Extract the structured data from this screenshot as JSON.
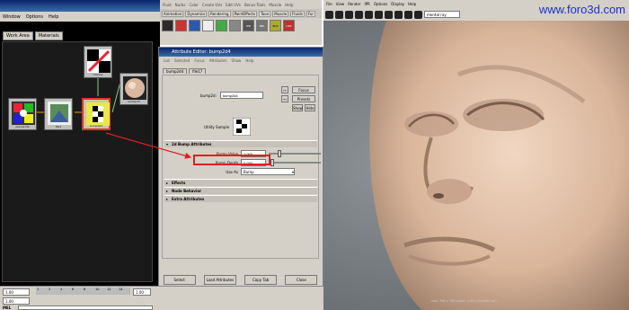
{
  "hypershade": {
    "menu": [
      "Window",
      "Options",
      "Help"
    ],
    "tabs": [
      "Work Area",
      "Materials"
    ],
    "nodes": [
      {
        "label": "place2dTe"
      },
      {
        "label": "file1"
      },
      {
        "label": "bump2d4"
      },
      {
        "label": "lambert3"
      },
      {
        "label": "checker"
      }
    ]
  },
  "maya": {
    "menu": [
      "Fluid",
      "Nurbs",
      "Color",
      "Create UVs",
      "Edit UVs",
      "Bonus Tools",
      "Muscle",
      "Help"
    ],
    "shelf_tabs": [
      "Animation",
      "Dynamics",
      "Rendering",
      "PaintEffects",
      "Toon",
      "Muscle",
      "Fluids",
      "Fur",
      "Hair"
    ],
    "shelf_icons": [
      "IPR",
      "MRI",
      "BCS",
      "DKS"
    ]
  },
  "attribute_editor": {
    "title": "Attribute Editor: bump2d4",
    "menu": [
      "List",
      "Selected",
      "Focus",
      "Attributes",
      "Show",
      "Help"
    ],
    "tabs": [
      "bump2d4",
      "file17"
    ],
    "node_label": "bump2d:",
    "node_value": "bump2d4",
    "focus": "Focus",
    "presets": "Presets",
    "show": "Show",
    "hide": "Hide",
    "utility_sample": "Utility Sample",
    "section_bump": "2d Bump Attributes",
    "bump_value_label": "Bump Value",
    "bump_value": "1.000",
    "bump_depth_label": "Bump Depth",
    "bump_depth": "0.030",
    "use_as_label": "Use As",
    "use_as": "Bump",
    "section_effects": "Effects",
    "section_node_behavior": "Node Behavior",
    "section_extra": "Extra Attributes",
    "select": "Select",
    "load_attributes": "Load Attributes",
    "copy_tab": "Copy Tab",
    "close": "Close"
  },
  "render_view": {
    "menu": [
      "File",
      "View",
      "Render",
      "IPR",
      "Options",
      "Display",
      "Help"
    ],
    "renderer": "mental ray",
    "watermark": "www.foro3d.com",
    "status": "size: 768 x 768 zoom: 1.000    (mental ray)"
  },
  "timeline": {
    "ruler": [
      "1",
      "2",
      "4",
      "6",
      "8",
      "10",
      "12",
      "14"
    ],
    "start": "1.00",
    "current": "1.00",
    "range": "1.00",
    "cmd_label": "MEL"
  },
  "colors": {
    "highlight": "#e02020",
    "maya_gray": "#d4d0c8",
    "titlebar": "#0a246a",
    "watermark": "#1c2fd0"
  }
}
